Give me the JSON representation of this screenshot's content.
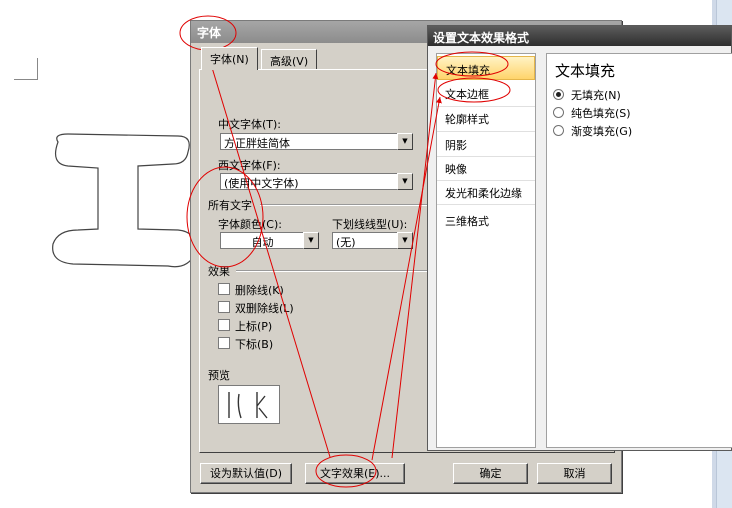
{
  "font_dialog": {
    "title": "字体",
    "tabs": [
      {
        "label": "字体(N)",
        "active": true
      },
      {
        "label": "高级(V)",
        "active": false
      }
    ],
    "chinese_font": {
      "label": "中文字体(T):",
      "value": "方正胖娃简体"
    },
    "western_font": {
      "label": "西文字体(F):",
      "value": "(使用中文字体)"
    },
    "all_text_group": "所有文字",
    "font_color": {
      "label": "字体颜色(C):",
      "value": "自动"
    },
    "underline": {
      "label": "下划线线型(U):",
      "value": "(无)"
    },
    "effects_group": "效果",
    "effects": [
      {
        "label": "删除线(K)",
        "checked": false
      },
      {
        "label": "双删除线(L)",
        "checked": false
      },
      {
        "label": "上标(P)",
        "checked": false
      },
      {
        "label": "下标(B)",
        "checked": false
      }
    ],
    "preview_label": "预览",
    "buttons": {
      "set_default": "设为默认值(D)",
      "text_effects": "文字效果(E)...",
      "ok": "确定",
      "cancel": "取消"
    }
  },
  "effects_dialog": {
    "title": "设置文本效果格式",
    "nav_items": [
      {
        "label": "文本填充",
        "selected": true
      },
      {
        "label": "文本边框",
        "selected": false
      },
      {
        "label": "轮廓样式",
        "selected": false
      },
      {
        "label": "阴影",
        "selected": false
      },
      {
        "label": "映像",
        "selected": false
      },
      {
        "label": "发光和柔化边缘",
        "selected": false
      },
      {
        "label": "三维格式",
        "selected": false
      }
    ],
    "content": {
      "heading": "文本填充",
      "options": [
        {
          "label": "无填充(N)",
          "selected": true
        },
        {
          "label": "纯色填充(S)",
          "selected": false
        },
        {
          "label": "渐变填充(G)",
          "selected": false
        }
      ]
    }
  },
  "colors": {
    "annotation_red": "#e00000",
    "dialog_face": "#d4d0c8",
    "nav_selected": "#ffd46b"
  }
}
